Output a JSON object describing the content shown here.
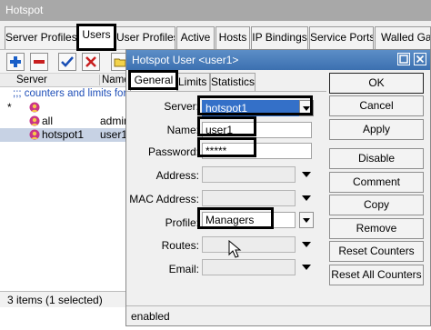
{
  "outer": {
    "title": "Hotspot",
    "tabs": [
      "Server Profiles",
      "Users",
      "User Profiles",
      "Active",
      "Hosts",
      "IP Bindings",
      "Service Ports",
      "Walled Garden"
    ],
    "columns": [
      "Server",
      "Name"
    ],
    "comment_row": ";;; counters and limits for",
    "rows": [
      {
        "server": "*",
        "name": ""
      },
      {
        "server": "all",
        "name": "admin"
      },
      {
        "server": "hotspot1",
        "name": "user1"
      }
    ],
    "status": "3 items (1 selected)"
  },
  "dialog": {
    "title": "Hotspot User <user1>",
    "tabs": [
      "General",
      "Limits",
      "Statistics"
    ],
    "fields": {
      "server": {
        "label": "Server:",
        "value": "hotspot1"
      },
      "name": {
        "label": "Name:",
        "value": "user1"
      },
      "password": {
        "label": "Password:",
        "value": "*****"
      },
      "address": {
        "label": "Address:",
        "value": ""
      },
      "mac": {
        "label": "MAC Address:",
        "value": ""
      },
      "profile": {
        "label": "Profile:",
        "value": "Managers"
      },
      "routes": {
        "label": "Routes:",
        "value": ""
      },
      "email": {
        "label": "Email:",
        "value": ""
      }
    },
    "buttons": [
      "OK",
      "Cancel",
      "Apply",
      "Disable",
      "Comment",
      "Copy",
      "Remove",
      "Reset Counters",
      "Reset All Counters"
    ],
    "status": "enabled"
  },
  "icons": [
    "add-icon",
    "remove-icon",
    "check-icon",
    "cross-icon",
    "folder-icon",
    "user-icon",
    "maximize-icon",
    "close-icon",
    "dropdown-icon",
    "mouse-cursor-icon"
  ],
  "colors": {
    "dialog_title": "#3c70b0",
    "selected_row": "#c7d2e4",
    "highlight": "#000000",
    "add": "#1a5fc8",
    "remove": "#c81f1f",
    "check": "#1a4fb5"
  }
}
